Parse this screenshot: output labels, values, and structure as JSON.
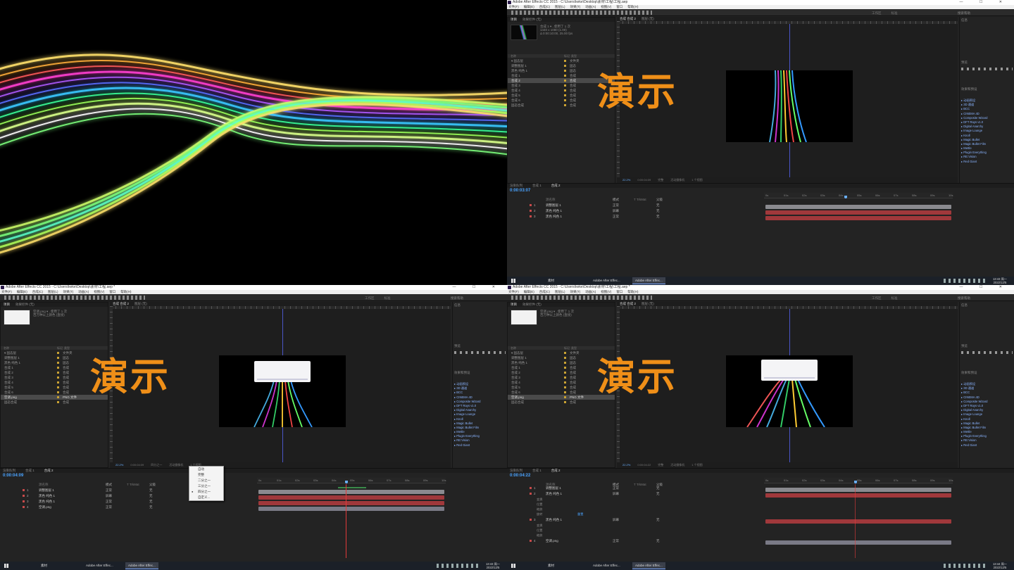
{
  "app": {
    "title_q2": "Adobe After Effects CC 2015 - C:\\Users\\keke\\Desktop\\素材\\工程\\工程.aep",
    "title_q3": "Adobe After Effects CC 2015 - C:\\Users\\keke\\Desktop\\素材\\工程.aep *",
    "title_q4": "Adobe After Effects CC 2015 - C:\\Users\\keke\\Desktop\\素材\\工程\\工程.aep *",
    "window_controls": "— ☐ ✕"
  },
  "menu": [
    "文件(F)",
    "编辑(E)",
    "合成(C)",
    "图层(L)",
    "效果(T)",
    "动画(A)",
    "视图(V)",
    "窗口",
    "帮助(H)"
  ],
  "workspace": {
    "items": [
      "工作区",
      "标准"
    ],
    "search": "搜索帮助"
  },
  "overlay_text": "演示",
  "project": {
    "tabs": [
      "项目",
      "效果控件 (无)"
    ],
    "info_q2": [
      "合成 1 ▾ , 使用了 1 次",
      "1440 x 1080 (1.00)",
      "Δ 0:00:10:00, 25.00 fps"
    ],
    "info_q3": [
      "空调.png ▾ , 使用了 1 次",
      "百万种以上颜色 (直接)"
    ],
    "header": [
      "名称",
      "标记",
      "类型"
    ],
    "rows_q2": [
      {
        "name": "▾ 固态层",
        "type": "文件夹"
      },
      {
        "name": "    调整图层 1",
        "type": "固态"
      },
      {
        "name": "    黑色 纯色 1",
        "type": "固态"
      },
      {
        "name": "合成 1",
        "type": "合成"
      },
      {
        "name": "合成 2",
        "type": "合成"
      },
      {
        "name": "合成 3",
        "type": "合成"
      },
      {
        "name": "合成 4",
        "type": "合成"
      },
      {
        "name": "合成 5",
        "type": "合成"
      },
      {
        "name": "合成 6",
        "type": "合成"
      },
      {
        "name": "固态合成",
        "type": "合成"
      }
    ],
    "rows_q3": [
      {
        "name": "▾ 固态层",
        "type": "文件夹"
      },
      {
        "name": "    调整图层 1",
        "type": "固态"
      },
      {
        "name": "    黑色 纯色 1",
        "type": "固态"
      },
      {
        "name": "合成 1",
        "type": "合成"
      },
      {
        "name": "合成 2",
        "type": "合成"
      },
      {
        "name": "合成 3",
        "type": "合成"
      },
      {
        "name": "合成 4",
        "type": "合成"
      },
      {
        "name": "合成 5",
        "type": "合成"
      },
      {
        "name": "合成 6",
        "type": "合成"
      },
      {
        "name": "空调.png",
        "type": "PNG 文件"
      },
      {
        "name": "固态合成",
        "type": "合成"
      }
    ]
  },
  "viewer": {
    "tabs": [
      "合成 合成 2",
      "图层 (无)"
    ],
    "footer": [
      "22.2%",
      "0:00:04:09",
      "完整",
      "活动摄像机",
      "1 个视图"
    ]
  },
  "right_panels": {
    "info": "信息",
    "preview": "预览",
    "effects_title": "效果和预设",
    "effects": [
      "▸ 动画预设",
      "▸ 3D 通道",
      "▸ BCC",
      "▸ CINEMA 4D",
      "▸ Composite Wizard",
      "▸ DFT Rays v1.0",
      "▸ Digital Anarchy",
      "▸ Image Lounge",
      "▸ Knoll",
      "▸ Magic Bullet",
      "▸ Magic Bullet Film",
      "▸ Mettle",
      "▸ Plugin Everything",
      "▸ RE:Vision",
      "▸ Red Giant"
    ],
    "paragraph": "段落",
    "character": "字符"
  },
  "timeline": {
    "tabs": [
      "渲染队列",
      "合成 1",
      "合成 2"
    ],
    "timecode_q2": "0:00:03:07",
    "timecode_q3": "0:00:04:09",
    "timecode_q4": "0:00:04:22",
    "ruler": [
      "0s",
      "01s",
      "02s",
      "03s",
      "04s",
      "05s",
      "06s",
      "07s",
      "08s",
      "09s",
      "10s"
    ],
    "col_headers": [
      "源名称",
      "模式",
      "T TrkMat",
      "父级"
    ],
    "layers_q2": [
      {
        "num": "1",
        "name": "调整图层 1",
        "mode": "正常",
        "parent": "无"
      },
      {
        "num": "2",
        "name": "黑色 纯色 1",
        "mode": "屏幕",
        "parent": "无"
      },
      {
        "num": "3",
        "name": "黑色 纯色 1",
        "mode": "正常",
        "parent": "无"
      }
    ],
    "layers_q3": [
      {
        "num": "1",
        "name": "调整图层 1",
        "mode": "正常",
        "parent": "无"
      },
      {
        "num": "2",
        "name": "黑色 纯色 1",
        "mode": "屏幕",
        "parent": "无"
      },
      {
        "num": "3",
        "name": "黑色 纯色 1",
        "mode": "正常",
        "parent": "无"
      },
      {
        "num": "4",
        "name": "空调.png",
        "mode": "正常",
        "parent": "无"
      }
    ],
    "layers_q4": [
      {
        "num": "1",
        "name": "调整图层 1",
        "mode": "正常",
        "parent": "无"
      },
      {
        "num": "2",
        "name": "黑色 纯色 1",
        "mode": "屏幕",
        "parent": "无"
      },
      {
        "num": "3",
        "name": "黑色 纯色 1",
        "mode": "屏幕",
        "parent": "无"
      },
      {
        "num": "4",
        "name": "空调.png",
        "mode": "正常",
        "parent": "无"
      }
    ],
    "sub_props": [
      "变换",
      "位置",
      "缩放",
      "旋转"
    ],
    "sub_label": "重置"
  },
  "resolution_menu": {
    "items": [
      "自动",
      "完整",
      "二分之一",
      "三分之一",
      "四分之一",
      "自定义..."
    ],
    "selected": "四分之一"
  },
  "taskbar": {
    "folder": "素材",
    "ae1": "Adobe After Effec...",
    "ae2": "Adobe After Effec...",
    "time_q2": "13:43 周一",
    "date": "2022/12/5",
    "time_q3": "13:43 周一",
    "time_q4": "13:44 周一"
  },
  "colors": {
    "accent": "#4aa3ff",
    "orange": "#ef8f18",
    "layer_red": "#a0383b"
  }
}
